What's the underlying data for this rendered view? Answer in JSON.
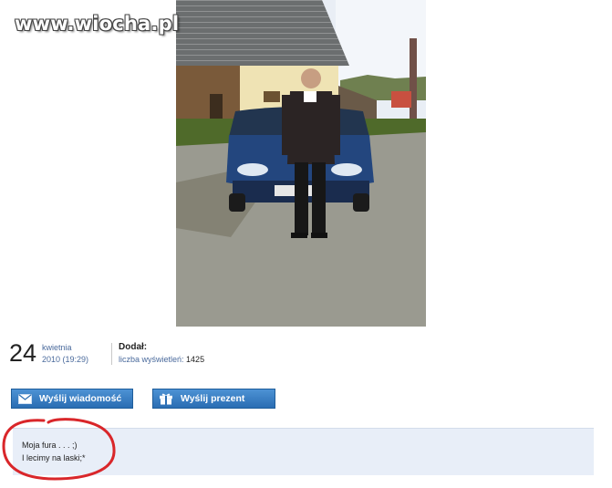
{
  "watermark": {
    "text": "www.wiocha.pl"
  },
  "post": {
    "date": {
      "day": "24",
      "month": "kwietnia",
      "year_time": "2010 (19:29)"
    },
    "added_label": "Dodał:",
    "views_label": "liczba wyświetleń:",
    "views_count": "1425"
  },
  "buttons": {
    "send_message": "Wyślij wiadomość",
    "send_gift": "Wyślij prezent"
  },
  "comment": {
    "line1": "Moja fura . . . ;)",
    "line2": "I lecimy na laski;*"
  },
  "colors": {
    "button": "#2f72b8",
    "link_text": "#4a6a9c",
    "comment_bg": "#e8eef8",
    "annotation": "#d9262a"
  },
  "icons": {
    "message": "envelope-icon",
    "gift": "gift-icon"
  }
}
